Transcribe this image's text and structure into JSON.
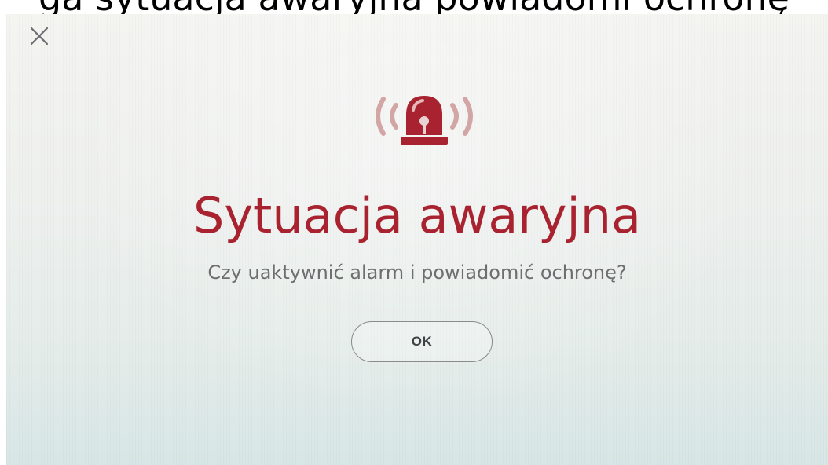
{
  "caption": {
    "text": "ga sytuacja awaryjna powiadomi ochronę"
  },
  "icons": {
    "close": "close-icon",
    "alarm": "alarm-siren-icon"
  },
  "dialog": {
    "title": "Sytuacja awaryjna",
    "message": "Czy uaktywnić alarm i powiadomić ochronę?",
    "ok_label": "OK"
  },
  "colors": {
    "accent": "#a8232f",
    "icon_muted": "#d3a6a6",
    "text_secondary": "#6c6e70",
    "background": "#eef0ee"
  }
}
